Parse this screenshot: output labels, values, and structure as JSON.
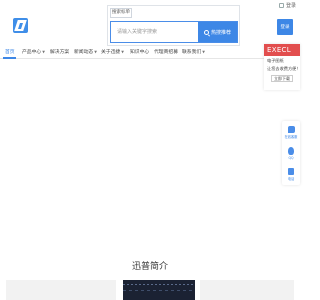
{
  "header": {
    "top_link": "登录",
    "login_button": "登录"
  },
  "search": {
    "tab_label": "搜索标单",
    "placeholder": "请输入关键字搜索",
    "button_label": "热搜推荐"
  },
  "nav": {
    "items": [
      {
        "label": "首页",
        "active": true,
        "dropdown": false
      },
      {
        "label": "产品中心",
        "active": false,
        "dropdown": true
      },
      {
        "label": "解决方案",
        "active": false,
        "dropdown": false
      },
      {
        "label": "新闻动态",
        "active": false,
        "dropdown": true
      },
      {
        "label": "关于迅捷",
        "active": false,
        "dropdown": true
      },
      {
        "label": "知识中心",
        "active": false,
        "dropdown": false
      },
      {
        "label": "代理商招募",
        "active": false,
        "dropdown": false
      },
      {
        "label": "联系我们",
        "active": false,
        "dropdown": true
      }
    ]
  },
  "promo": {
    "title": "EXECL",
    "line1": "电子图纸",
    "line2": "让您去收费方便！",
    "button": "立即下载"
  },
  "side_panel": {
    "items": [
      {
        "label": "在线客服",
        "icon": "chat-icon"
      },
      {
        "label": "QQ",
        "icon": "qq-icon"
      },
      {
        "label": "电话",
        "icon": "phone-icon"
      }
    ]
  },
  "section": {
    "title": "迅普简介"
  },
  "colors": {
    "accent": "#3d87e6",
    "promo": "#e24e4e"
  }
}
